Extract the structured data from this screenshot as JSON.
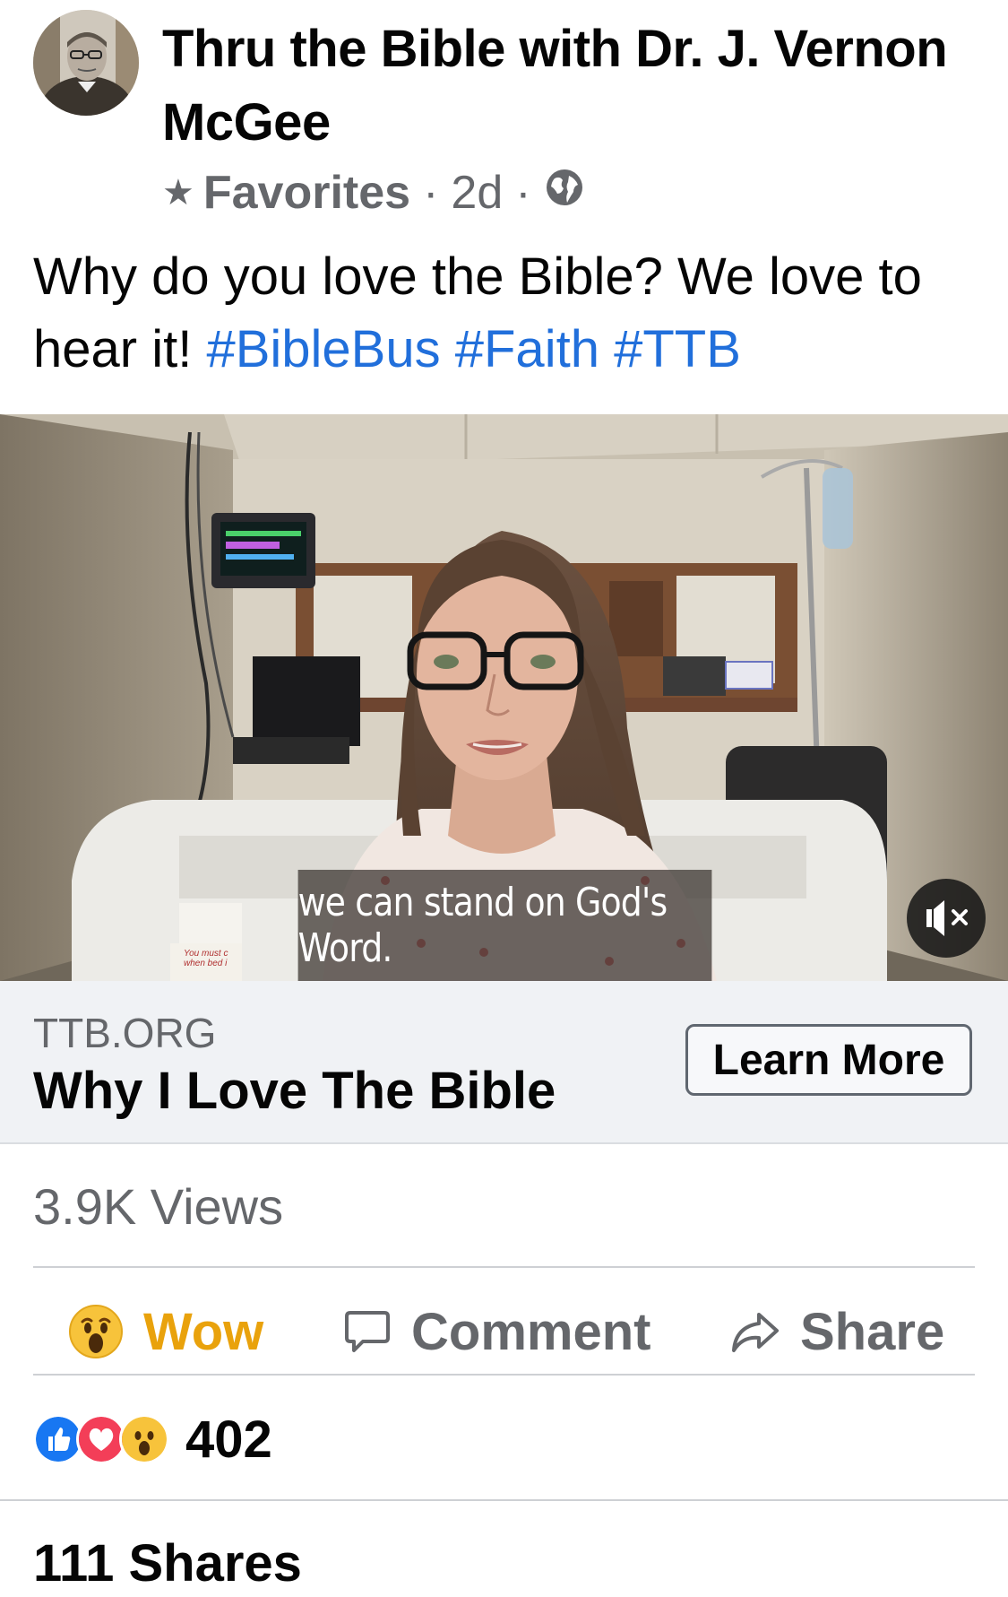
{
  "post": {
    "author": "Thru the Bible with Dr. J. Vernon McGee",
    "favorites_label": "Favorites",
    "time": "2d",
    "caption_text": "Why do you love the Bible? We love to hear it!",
    "hashtags": [
      "#BibleBus",
      "#Faith",
      "#TTB"
    ]
  },
  "video": {
    "subtitle": "we can stand on God's Word.",
    "bed_sign_text": "You must c when bed i"
  },
  "link": {
    "domain": "TTB.ORG",
    "title": "Why I Love The Bible",
    "cta": "Learn More"
  },
  "stats": {
    "views": "3.9K Views",
    "reactions_count": "402",
    "shares": "111 Shares"
  },
  "actions": {
    "wow": "Wow",
    "comment": "Comment",
    "share": "Share"
  },
  "colors": {
    "hashtag": "#216fdb",
    "wow": "#e9a20c",
    "secondary_text": "#65676b",
    "like_blue": "#1877f2",
    "love_red": "#f33e58"
  },
  "icons": [
    "profile-avatar",
    "star-icon",
    "globe-icon",
    "mute-icon",
    "wow-icon",
    "comment-icon",
    "share-icon",
    "like-reaction-icon",
    "love-reaction-icon",
    "wow-reaction-icon"
  ]
}
